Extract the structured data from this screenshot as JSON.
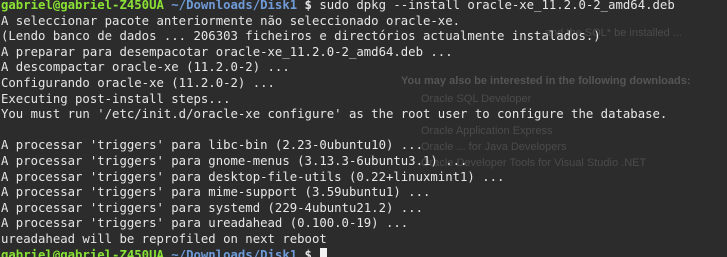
{
  "colors": {
    "background": "#2c2c2c",
    "text": "#e6e6e6",
    "prompt_user": "#8ae234",
    "prompt_path": "#6f9bd8"
  },
  "prompt": {
    "user_host": "gabriel@gabriel-Z450UA",
    "path": "~/Downloads/Disk1",
    "symbol": "$"
  },
  "command": "sudo dpkg --install oracle-xe_11.2.0-2_amd64.deb",
  "output": [
    "A seleccionar pacote anteriormente não seleccionado oracle-xe.",
    "(Lendo banco de dados ... 206303 ficheiros e directórios actualmente instalados.)",
    "A preparar para desempacotar oracle-xe_11.2.0-2_amd64.deb ...",
    "A descompactar oracle-xe (11.2.0-2) ...",
    "Configurando oracle-xe (11.2.0-2) ...",
    "Executing post-install steps...",
    "You must run '/etc/init.d/oracle-xe configure' as the root user to configure the database.",
    "",
    "A processar 'triggers' para libc-bin (2.23-0ubuntu10) ...",
    "A processar 'triggers' para gnome-menus (3.13.3-6ubuntu3.1) ...",
    "A processar 'triggers' para desktop-file-utils (0.22+linuxmint1) ...",
    "A processar 'triggers' para mime-support (3.59ubuntu1) ...",
    "A processar 'triggers' para systemd (229-4ubuntu21.2) ...",
    "A processar 'triggers' para ureadahead (0.100.0-19) ...",
    "ureadahead will be reprofiled on next reboot"
  ],
  "background_window": {
    "line1": "and the SQL* be installed ...",
    "heading": "You may also be interested in the following downloads:",
    "item1": "Oracle SQL Developer",
    "item2": "Oracle Application Express",
    "item3": "Oracle ... for Java Developers",
    "item4": "Oracle Developer Tools for Visual Studio .NET"
  }
}
